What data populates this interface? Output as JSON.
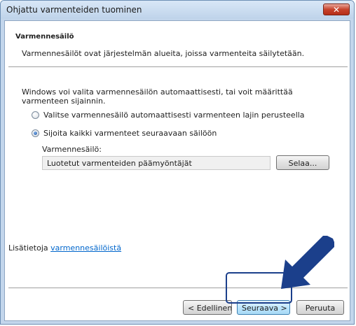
{
  "window": {
    "title": "Ohjattu varmenteiden tuominen",
    "close_glyph": "✕"
  },
  "header": {
    "title": "Varmennesäilö",
    "description": "Varmennesäilöt ovat järjestelmän alueita, joissa varmenteita säilytetään."
  },
  "body": {
    "intro": "Windows voi valita varmennesäilön automaattisesti, tai voit määrittää varmenteen sijainnin.",
    "options": [
      {
        "label": "Valitse varmennesäilö automaattisesti varmenteen lajin perusteella",
        "checked": false
      },
      {
        "label": "Sijoita kaikki varmenteet seuraavaan säilöön",
        "checked": true
      }
    ],
    "store_label": "Varmennesäilö:",
    "store_value": "Luotetut varmenteiden päämyöntäjät",
    "browse_label": "Selaa..."
  },
  "more_info": {
    "prefix": "Lisätietoja",
    "link": "varmennesäilöistä"
  },
  "footer": {
    "back_label": "< Edellinen",
    "next_label": "Seuraava >",
    "cancel_label": "Peruuta"
  },
  "annotation": {
    "highlight_color": "#1b3f8b",
    "arrow_color": "#1b3f8b",
    "arrow_icon": "arrow-icon"
  }
}
